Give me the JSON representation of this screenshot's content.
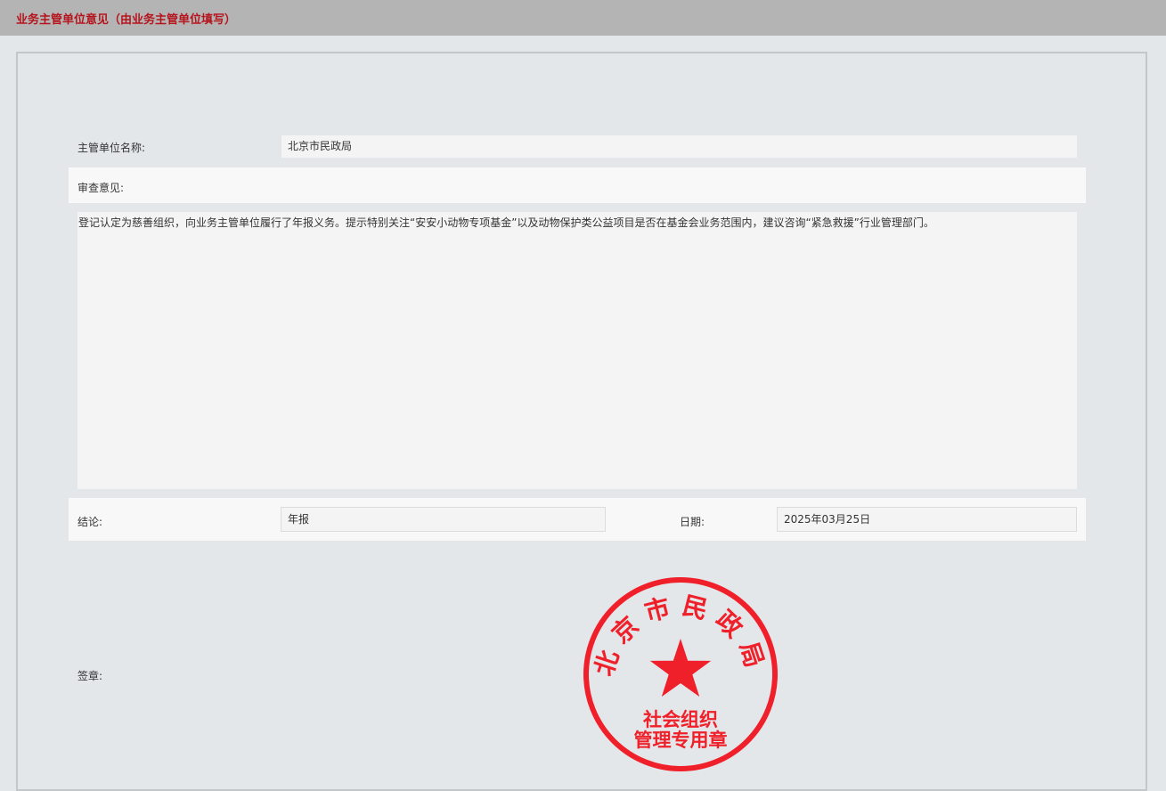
{
  "header": {
    "title": "业务主管单位意见（由业务主管单位填写）"
  },
  "form": {
    "authority_label": "主管单位名称:",
    "authority_value": "北京市民政局",
    "review_label": "审查意见:",
    "review_text": "登记认定为慈善组织，向业务主管单位履行了年报义务。提示特别关注“安安小动物专项基金”以及动物保护类公益项目是否在基金会业务范围内，建议咨询“紧急救援”行业管理部门。",
    "conclusion_label": "结论:",
    "conclusion_value": "年报",
    "date_label": "日期:",
    "date_value": "2025年03月25日",
    "seal_label": "签章:"
  },
  "seal": {
    "ring_text": "北京市民政局",
    "line1": "社会组织",
    "line2": "管理专用章",
    "color": "#f0202a"
  },
  "colors": {
    "header_bg": "#b4b4b4",
    "header_title": "#b5141c",
    "page_bg": "#e3e7ea"
  }
}
